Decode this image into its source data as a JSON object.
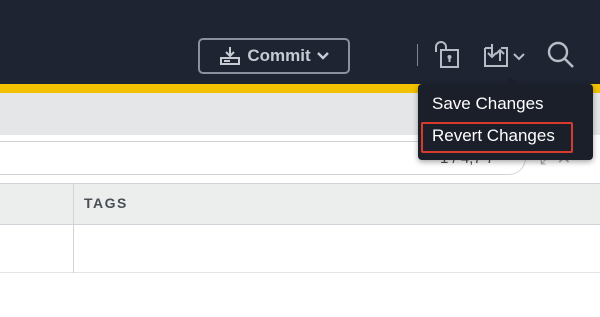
{
  "toolbar": {
    "commit_label": "Commit",
    "commit_icon": "upload-tray-icon",
    "lock_icon": "lock-icon",
    "sync_icon": "sync-changes-icon",
    "search_icon": "search-icon"
  },
  "colors": {
    "topbar": "#1e2432",
    "accent": "#f2c200",
    "menu_bg": "#1b1f29",
    "highlight": "#d93a2e"
  },
  "search": {
    "counter": "1 / 4,7 7"
  },
  "table": {
    "columns": [
      "TAGS"
    ]
  },
  "menu": {
    "items": [
      {
        "label": "Save Changes"
      },
      {
        "label": "Revert Changes"
      }
    ]
  }
}
